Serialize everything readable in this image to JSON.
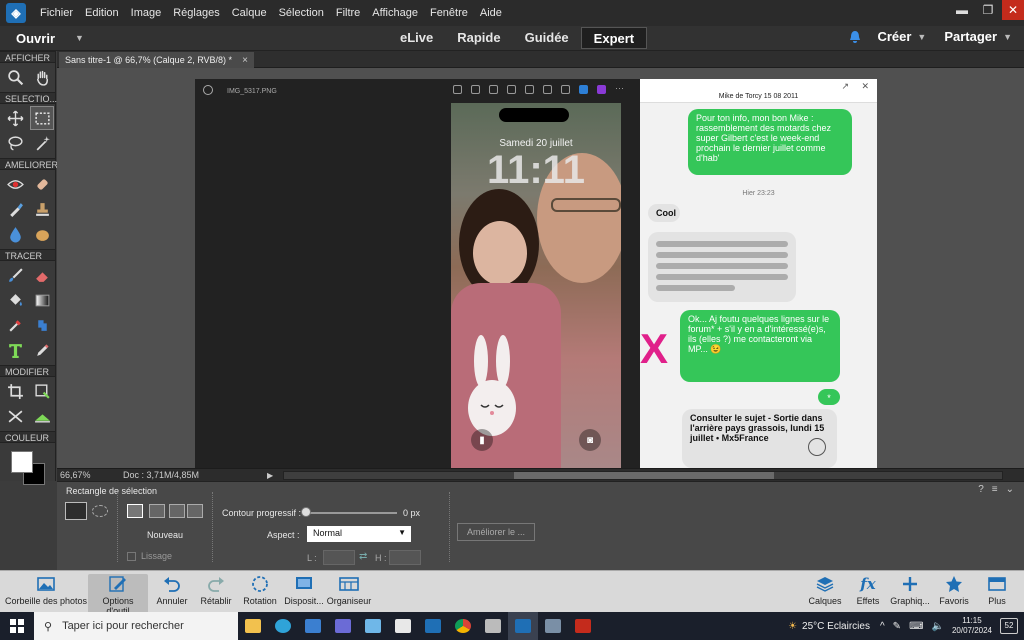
{
  "menu": [
    "Fichier",
    "Edition",
    "Image",
    "Réglages",
    "Calque",
    "Sélection",
    "Filtre",
    "Affichage",
    "Fenêtre",
    "Aide"
  ],
  "modebar": {
    "open_label": "Ouvrir",
    "tabs": [
      "eLive",
      "Rapide",
      "Guidée",
      "Expert"
    ],
    "active_tab": "Expert",
    "create_label": "Créer",
    "share_label": "Partager"
  },
  "tool_sections": {
    "view": "AFFICHER",
    "select": "SELECTIO...",
    "enhance": "AMELIORER",
    "draw": "TRACER",
    "modify": "MODIFIER",
    "color": "COULEUR"
  },
  "document": {
    "tab_label": "Sans titre-1 @ 66,7% (Calque 2, RVB/8) *",
    "zoom": "66,67%",
    "doc_size": "Doc : 3,71M/4,85M"
  },
  "image_content": {
    "viewer_filename": "IMG_5317.PNG",
    "lock_date": "Samedi 20 juillet",
    "lock_time": "11:11",
    "chat_contact": "Mike de Torcy  15 08 2011",
    "bubble1": "Pour ton info, mon bon Mike : rassemblement des motards chez super Gilbert c'est le week-end prochain le dernier juillet comme d'hab'",
    "chat_time": "Hier 23:23",
    "bubble2": "Cool",
    "redx": "X",
    "bubble4": "Ok... Aj foutu quelques lignes sur le forum* + s'il y en a d'intéressé(e)s, ils (elles ?) me contacteront via MP... 😉",
    "bubble5": "*",
    "bubble6": "Consulter le sujet - Sortie dans l'arrière pays grassois, lundi 15 juillet • Mx5France"
  },
  "options": {
    "title": "Rectangle de sélection",
    "mode_label": "Nouveau",
    "smoothing_label": "Lissage",
    "feather_label": "Contour progressif :",
    "feather_value": "0 px",
    "aspect_label": "Aspect :",
    "aspect_value": "Normal",
    "width_label": "L :",
    "height_label": "H :",
    "refine_label": "Améliorer le ..."
  },
  "bottombar": [
    {
      "label": "Corbeille des photos",
      "icon": "photo-bin-icon"
    },
    {
      "label": "Options d'outil",
      "icon": "tool-options-icon"
    },
    {
      "label": "Annuler",
      "icon": "undo-icon"
    },
    {
      "label": "Rétablir",
      "icon": "redo-icon"
    },
    {
      "label": "Rotation",
      "icon": "rotate-icon"
    },
    {
      "label": "Disposit...",
      "icon": "layout-icon"
    },
    {
      "label": "Organiseur",
      "icon": "organizer-icon"
    },
    {
      "label": "Calques",
      "icon": "layers-icon"
    },
    {
      "label": "Effets",
      "icon": "effects-icon"
    },
    {
      "label": "Graphiq...",
      "icon": "graphics-icon"
    },
    {
      "label": "Favoris",
      "icon": "favorites-icon"
    },
    {
      "label": "Plus",
      "icon": "more-icon"
    }
  ],
  "taskbar": {
    "search_placeholder": "Taper ici pour rechercher",
    "weather": "25°C  Eclaircies",
    "time": "11:15",
    "date": "20/07/2024",
    "notifications": "52"
  },
  "colors": {
    "accent": "#1f6fb5",
    "chat_green": "#35c659",
    "redx": "#e0208a"
  }
}
